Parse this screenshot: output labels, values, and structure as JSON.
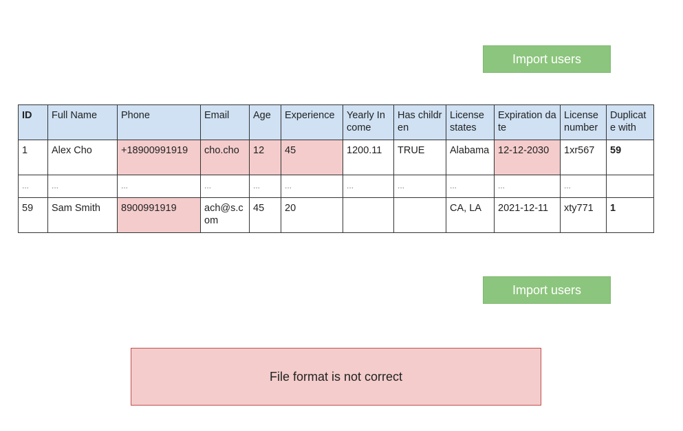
{
  "import_button_label": "Import users",
  "table": {
    "headers": [
      "ID",
      "Full Name",
      "Phone",
      "Email",
      "Age",
      "Experience",
      "Yearly Income",
      "Has children",
      "License states",
      "Expiration date",
      "License number",
      "Duplicate with"
    ],
    "rows": [
      [
        "1",
        "Alex Cho",
        "+18900991919",
        "cho.cho",
        "12",
        "45",
        "1200.11",
        "TRUE",
        "Alabama",
        "12-12-2030",
        "1xr567",
        "59"
      ],
      [
        "...",
        "...",
        "...",
        "...",
        "...",
        "...",
        "...",
        "...",
        "...",
        "...",
        "...",
        ""
      ],
      [
        "59",
        "Sam Smith",
        "8900991919",
        "ach@s.com",
        "45",
        "20",
        "",
        "",
        "CA, LA",
        "2021-12-11",
        "xty771",
        "1"
      ]
    ]
  },
  "error_message": "File format is not correct",
  "colors": {
    "header_bg": "#cfe1f3",
    "error_cell_bg": "#f4cccc",
    "button_bg": "#8cc57d",
    "error_box_bg": "#f4cccc",
    "error_box_border": "#c0504d"
  }
}
